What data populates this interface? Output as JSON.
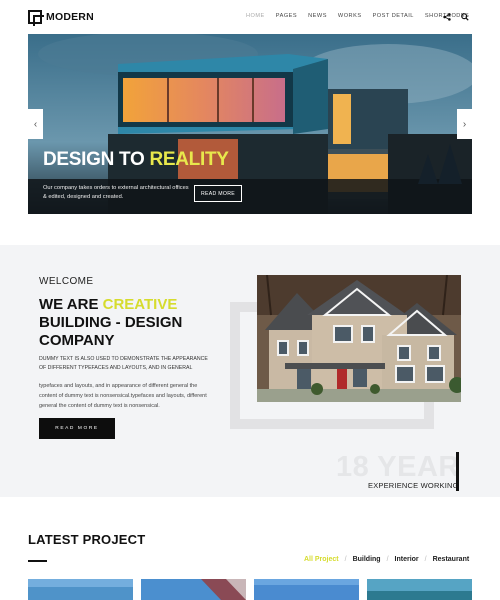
{
  "header": {
    "logo_text": "MODERN",
    "nav": [
      "HOME",
      "PAGES",
      "NEWS",
      "WORKS",
      "POST DETAIL",
      "SHORTCODES"
    ],
    "active_nav": "HOME",
    "icons": [
      "share-icon",
      "search-icon"
    ]
  },
  "hero": {
    "title_part1": "DESIGN TO ",
    "title_part2": "REALITY",
    "description": "Our company takes orders to external architectural offices & edited, designed and created.",
    "button_label": "READ MORE",
    "prev_arrow": "‹",
    "next_arrow": "›"
  },
  "about": {
    "welcome": "WELCOME",
    "title_part1": "WE ARE ",
    "title_highlight": "CREATIVE",
    "title_part2": "BUILDING - DESIGN COMPANY",
    "paragraph1": "DUMMY TEXT IS ALSO USED TO DEMONSTRATE THE APPEARANCE OF DIFFERENT TYPEFACES AND LAYOUTS, AND IN GENERAL",
    "paragraph2": "typefaces and layouts, and in appearance of different general the content of dummy text is nonsensical.typefaces and layouts, different general the content of dummy text is nonsensical.",
    "button_label": "READ MORE",
    "year_big": "18 YEAR",
    "year_sub": "EXPERIENCE WORKING"
  },
  "projects": {
    "title": "LATEST PROJECT",
    "filters": [
      "All Project",
      "Building",
      "Interior",
      "Restaurant"
    ],
    "active_filter": "All Project"
  },
  "colors": {
    "accent_yellow": "#d6dc2e",
    "dark": "#0d0d0d",
    "section_bg": "#f3f4f6"
  }
}
